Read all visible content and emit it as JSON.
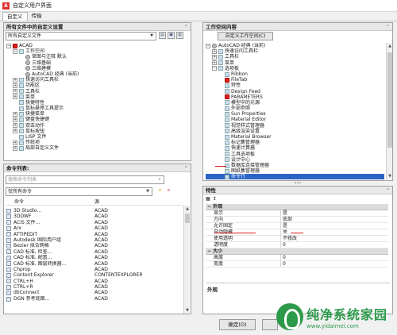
{
  "window": {
    "title": "自定义用户界面",
    "app_icon": "A"
  },
  "tabs": [
    {
      "label": "自定义"
    },
    {
      "label": "传输"
    }
  ],
  "customizations_panel": {
    "title": "所有文件中的自定义设置",
    "dropdown_value": "所有自定义文件",
    "tree": [
      {
        "label": "ACAD",
        "expander": "−",
        "icon": "red",
        "indent": 0
      },
      {
        "label": "工作空间",
        "expander": "−",
        "icon": "plain",
        "indent": 1
      },
      {
        "label": "草图与注释 默认",
        "expander": "",
        "icon": "gear",
        "indent": 2
      },
      {
        "label": "三维基础",
        "expander": "",
        "icon": "gear",
        "indent": 2
      },
      {
        "label": "三维建模",
        "expander": "",
        "icon": "gear",
        "indent": 2
      },
      {
        "label": "AutoCAD 经典 (当前)",
        "expander": "",
        "icon": "gear",
        "indent": 2
      },
      {
        "label": "快速访问工具栏",
        "expander": "+",
        "icon": "plain",
        "indent": 1
      },
      {
        "label": "功能区",
        "expander": "+",
        "icon": "plain",
        "indent": 1
      },
      {
        "label": "工具栏",
        "expander": "+",
        "icon": "plain",
        "indent": 1
      },
      {
        "label": "菜单",
        "expander": "+",
        "icon": "plain",
        "indent": 1
      },
      {
        "label": "快捷特性",
        "expander": "",
        "icon": "plain",
        "indent": 1
      },
      {
        "label": "鼠标悬停工具提示",
        "expander": "",
        "icon": "plain",
        "indent": 1
      },
      {
        "label": "快捷菜单",
        "expander": "+",
        "icon": "plain",
        "indent": 1
      },
      {
        "label": "键盘快捷键",
        "expander": "+",
        "icon": "plain",
        "indent": 1
      },
      {
        "label": "双击动作",
        "expander": "+",
        "icon": "plain",
        "indent": 1
      },
      {
        "label": "鼠标按钮",
        "expander": "+",
        "icon": "plain",
        "indent": 1
      },
      {
        "label": "LISP 文件",
        "expander": "",
        "icon": "plain",
        "indent": 1
      },
      {
        "label": "传统项",
        "expander": "+",
        "icon": "plain",
        "indent": 1
      },
      {
        "label": "局部自定义文件",
        "expander": "+",
        "icon": "plain",
        "indent": 1
      }
    ]
  },
  "command_panel": {
    "title": "命令列表:",
    "search_placeholder": "搜索命令列表",
    "filter_value": "仅所有命令",
    "columns": {
      "command": "命令",
      "source": "源"
    },
    "commands": [
      {
        "name": "3D Studio...",
        "source": "ACAD"
      },
      {
        "name": "3DDWF",
        "source": "ACAD"
      },
      {
        "name": "ACIS 文件...",
        "source": "ACAD"
      },
      {
        "name": "Arx",
        "source": "ACAD"
      },
      {
        "name": "ATTIPEDIT",
        "source": "ACAD"
      },
      {
        "name": "Autodesk 国际用户组",
        "source": "ACAD"
      },
      {
        "name": "Bezier 拟合网格",
        "source": "ACAD"
      },
      {
        "name": "CAD 标准, 检查...",
        "source": "ACAD"
      },
      {
        "name": "CAD 标准, 配置...",
        "source": "ACAD"
      },
      {
        "name": "CAD 标准, 图层转换器...",
        "source": "ACAD"
      },
      {
        "name": "Chprop",
        "source": "ACAD"
      },
      {
        "name": "Content Explorer",
        "source": "CONTENTEXPLORER"
      },
      {
        "name": "CTRL+H",
        "source": "ACAD"
      },
      {
        "name": "CTRL+R",
        "source": "ACAD"
      },
      {
        "name": "dbConnect",
        "source": "ACAD"
      },
      {
        "name": "DGN 参考底图...",
        "source": "ACAD"
      }
    ]
  },
  "workspace_panel": {
    "title": "工作空间内容",
    "customize_button": "自定义工作空间(C)",
    "tree": [
      {
        "label": "AutoCAD 经典 (当前)",
        "expander": "−",
        "icon": "gear",
        "indent": 0,
        "selected": false
      },
      {
        "label": "快速访问工具栏",
        "expander": "+",
        "icon": "plain",
        "indent": 1,
        "selected": false
      },
      {
        "label": "工具栏",
        "expander": "+",
        "icon": "plain",
        "indent": 1,
        "selected": false
      },
      {
        "label": "菜单",
        "expander": "+",
        "icon": "plain",
        "indent": 1,
        "selected": false
      },
      {
        "label": "选项板",
        "expander": "−",
        "icon": "plain",
        "indent": 1,
        "selected": false
      },
      {
        "label": "Ribbon",
        "expander": "",
        "icon": "plain",
        "indent": 2,
        "selected": false
      },
      {
        "label": "FileTab",
        "expander": "",
        "icon": "red",
        "indent": 2,
        "selected": false
      },
      {
        "label": "特性",
        "expander": "",
        "icon": "plain",
        "indent": 2,
        "selected": false
      },
      {
        "label": "Design Feed",
        "expander": "",
        "icon": "plain",
        "indent": 2,
        "selected": false
      },
      {
        "label": "PARAMETERS",
        "expander": "",
        "icon": "red",
        "indent": 2,
        "selected": false
      },
      {
        "label": "模型中的光源",
        "expander": "",
        "icon": "plain",
        "indent": 2,
        "selected": false
      },
      {
        "label": "外部参照",
        "expander": "",
        "icon": "plain",
        "indent": 2,
        "selected": false
      },
      {
        "label": "Sun Properties",
        "expander": "",
        "icon": "plain",
        "indent": 2,
        "selected": false
      },
      {
        "label": "Material Editor",
        "expander": "",
        "icon": "plain",
        "indent": 2,
        "selected": false
      },
      {
        "label": "视觉样式管理器",
        "expander": "",
        "icon": "plain",
        "indent": 2,
        "selected": false
      },
      {
        "label": "高级渲染设置",
        "expander": "",
        "icon": "plain",
        "indent": 2,
        "selected": false
      },
      {
        "label": "Material Browser",
        "expander": "",
        "icon": "plain",
        "indent": 2,
        "selected": false
      },
      {
        "label": "标记集管理器",
        "expander": "",
        "icon": "plain",
        "indent": 2,
        "selected": false
      },
      {
        "label": "快速计算器",
        "expander": "",
        "icon": "plain",
        "indent": 2,
        "selected": false
      },
      {
        "label": "工具选项板",
        "expander": "",
        "icon": "plain",
        "indent": 2,
        "selected": false
      },
      {
        "label": "设计中心",
        "expander": "",
        "icon": "plain",
        "indent": 2,
        "selected": false
      },
      {
        "label": "数据库连接管理器",
        "expander": "",
        "icon": "plain",
        "indent": 2,
        "selected": false
      },
      {
        "label": "图纸集管理器",
        "expander": "",
        "icon": "plain",
        "indent": 2,
        "selected": false
      },
      {
        "label": "命令行",
        "expander": "",
        "icon": "plain",
        "indent": 2,
        "selected": true
      },
      {
        "label": "Layer Properties Manager",
        "expander": "",
        "icon": "plain",
        "indent": 2,
        "selected": false
      },
      {
        "label": "功能区选项卡",
        "expander": "+",
        "icon": "plain",
        "indent": 1,
        "selected": false
      }
    ]
  },
  "properties_panel": {
    "title": "特性",
    "categories": [
      {
        "name": "外观",
        "rows": [
          {
            "key": "显示",
            "value": "是"
          },
          {
            "key": "方向",
            "value": "底部"
          },
          {
            "key": "允许固定",
            "value": "是"
          },
          {
            "key": "自动隐藏",
            "value": "关"
          },
          {
            "key": "使用透明",
            "value": "不修改"
          },
          {
            "key": "透明度",
            "value": "0"
          }
        ]
      },
      {
        "name": "大小",
        "rows": [
          {
            "key": "高度",
            "value": "0"
          },
          {
            "key": "宽度",
            "value": "0"
          }
        ]
      }
    ],
    "description_title": "外观"
  },
  "footer": {
    "ok_label": "确定(O)"
  },
  "watermark": {
    "title": "纯净系统家园",
    "url": "www.yidaimei.com"
  },
  "colors": {
    "selection": "#2a64c5",
    "annotation_red": "#e21b1b",
    "watermark_green": "#2d9a4b"
  }
}
